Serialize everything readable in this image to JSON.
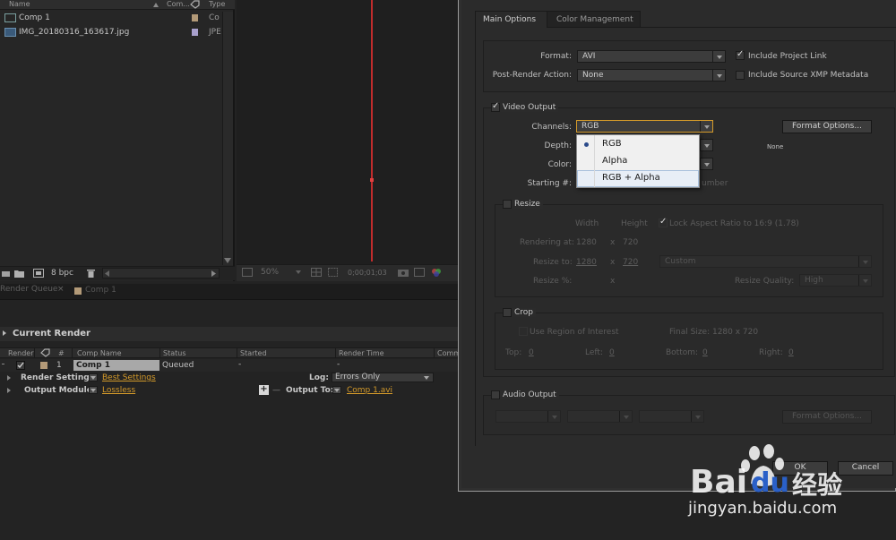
{
  "project": {
    "columns": {
      "name": "Name",
      "comment": "Com...",
      "type": "Type"
    },
    "items": [
      {
        "name": "Comp 1",
        "type": "Co",
        "swatch": "#b39a78"
      },
      {
        "name": "IMG_20180316_163617.jpg",
        "type": "JPE",
        "swatch": "#a8a0cc"
      }
    ],
    "bpc": "8 bpc"
  },
  "viewer": {
    "zoom": "50%",
    "timecode": "0;00;01;03"
  },
  "tabs": {
    "render_queue": "Render Queue",
    "render_queue_close": "×",
    "comp": "Comp 1"
  },
  "render_queue": {
    "section_title": "Current Render",
    "columns": {
      "render": "Render",
      "num": "#",
      "comp_name": "Comp Name",
      "status": "Status",
      "started": "Started",
      "render_time": "Render Time",
      "comment": "Comme"
    },
    "item": {
      "number": "1",
      "comp_name": "Comp 1",
      "status": "Queued",
      "started": "-",
      "render_time": "-"
    },
    "render_settings_label": "Render Settings:",
    "render_settings_value": "Best Settings",
    "log_label": "Log:",
    "log_value": "Errors Only",
    "output_module_label": "Output Module:",
    "output_module_value": "Lossless",
    "output_to_label": "Output To:",
    "output_to_value": "Comp 1.avi",
    "plus": "+",
    "minus": "—"
  },
  "dialog": {
    "tabs": {
      "main": "Main Options",
      "color": "Color Management"
    },
    "format_label": "Format:",
    "format_value": "AVI",
    "post_render_label": "Post-Render Action:",
    "post_render_value": "None",
    "include_project_link": "Include Project Link",
    "include_xmp": "Include Source XMP Metadata",
    "video_output": "Video Output",
    "channels_label": "Channels:",
    "channels_value": "RGB",
    "format_options_button": "Format Options...",
    "depth_label": "Depth:",
    "color_label": "Color:",
    "starting_label": "Starting #:",
    "starting_suffix": "umber",
    "format_options_none": "None",
    "channels_options": [
      "RGB",
      "Alpha",
      "RGB + Alpha"
    ],
    "resize": {
      "title": "Resize",
      "width_col": "Width",
      "height_col": "Height",
      "lock_aspect": "Lock Aspect Ratio to 16:9 (1.78)",
      "rendering_at_label": "Rendering at:",
      "rendering_at_w": "1280",
      "rendering_at_x": "x",
      "rendering_at_h": "720",
      "resize_to_label": "Resize to:",
      "resize_to_w": "1280",
      "resize_to_x": "x",
      "resize_to_h": "720",
      "preset": "Custom",
      "resize_pct_label": "Resize %:",
      "resize_pct_x": "x",
      "quality_label": "Resize Quality:",
      "quality_value": "High"
    },
    "crop": {
      "title": "Crop",
      "use_roi": "Use Region of Interest",
      "final_size": "Final Size: 1280 x 720",
      "top_label": "Top:",
      "top_value": "0",
      "left_label": "Left:",
      "left_value": "0",
      "bottom_label": "Bottom:",
      "bottom_value": "0",
      "right_label": "Right:",
      "right_value": "0"
    },
    "audio_output": "Audio Output",
    "audio_format_options": "Format Options...",
    "ok_button": "OK",
    "cancel_button": "Cancel"
  },
  "watermark": {
    "brand_bai": "Bai",
    "brand_du": "du",
    "brand_jingyan": "经验",
    "url": "jingyan.baidu.com"
  },
  "colors": {
    "accent_link": "#d49a2a",
    "guide_red": "#c02c2c",
    "popup_bg": "#f0f0f0"
  }
}
